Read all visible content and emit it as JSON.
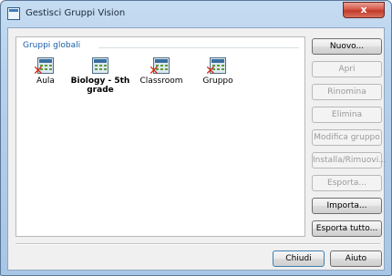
{
  "window": {
    "title": "Gestisci Gruppi Vision",
    "close_label": "x"
  },
  "groups_panel": {
    "legend": "Gruppi globali",
    "items": [
      {
        "label": "Aula",
        "bold": false,
        "icon": "grid-icon-with-red-x"
      },
      {
        "label": "Biology - 5th grade",
        "bold": true,
        "icon": "grid-icon"
      },
      {
        "label": "Classroom",
        "bold": false,
        "icon": "grid-icon-with-red-x"
      },
      {
        "label": "Gruppo",
        "bold": false,
        "icon": "grid-icon-with-red-x"
      }
    ]
  },
  "side_buttons": {
    "nuovo": "Nuovo...",
    "apri": "Apri",
    "rinomina": "Rinomina",
    "elimina": "Elimina",
    "modifica": "Modifica gruppo",
    "installa": "Installa/Rimuovi...",
    "esporta": "Esporta...",
    "importa": "Importa...",
    "esporta_tutto": "Esporta tutto..."
  },
  "bottom_buttons": {
    "chiudi": "Chiudi",
    "aiuto": "Aiuto"
  },
  "colors": {
    "title_bar": "#b7d0ea",
    "legend_text": "#1a5ea8",
    "close_button": "#c23a2a",
    "delete_mark": "#d12d1a"
  }
}
